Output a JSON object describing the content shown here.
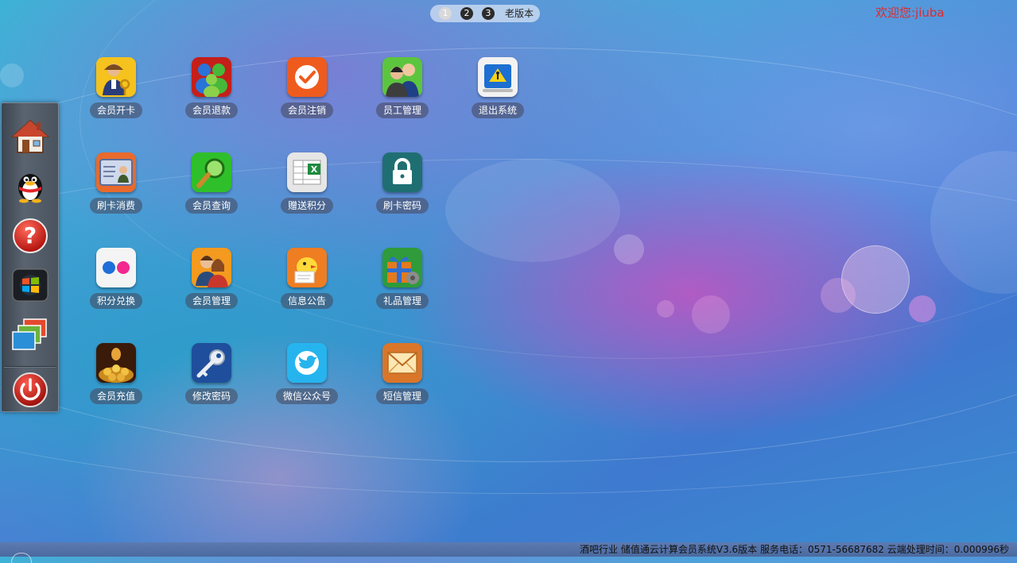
{
  "pager": {
    "pages": [
      "1",
      "2",
      "3"
    ],
    "active_page": "1",
    "old_version": "老版本"
  },
  "welcome": "欢迎您:jiuba",
  "dock": [
    "home-icon",
    "qq-penguin-icon",
    "help-icon",
    "windows-icon",
    "windows-stack-icon",
    "power-icon"
  ],
  "apps": [
    {
      "label": "会员开卡",
      "icon": "member-card-icon"
    },
    {
      "label": "会员退款",
      "icon": "refund-users-icon"
    },
    {
      "label": "会员注销",
      "icon": "checkmark-icon"
    },
    {
      "label": "员工管理",
      "icon": "staff-icon"
    },
    {
      "label": "退出系统",
      "icon": "exit-icon"
    },
    {
      "label": "刷卡消费",
      "icon": "id-card-icon"
    },
    {
      "label": "会员查询",
      "icon": "magnifier-icon"
    },
    {
      "label": "赠送积分",
      "icon": "spreadsheet-icon"
    },
    {
      "label": "刷卡密码",
      "icon": "lock-icon"
    },
    {
      "label": "积分兑换",
      "icon": "flickr-icon"
    },
    {
      "label": "会员管理",
      "icon": "member-pair-icon"
    },
    {
      "label": "信息公告",
      "icon": "chick-notice-icon"
    },
    {
      "label": "礼品管理",
      "icon": "gift-icon"
    },
    {
      "label": "会员充值",
      "icon": "gold-coins-icon"
    },
    {
      "label": "修改密码",
      "icon": "key-icon"
    },
    {
      "label": "微信公众号",
      "icon": "bird-icon"
    },
    {
      "label": "短信管理",
      "icon": "envelope-icon"
    }
  ],
  "status_bar": "酒吧行业 储值通云计算会员系统V3.6版本 服务电话：0571-56687682 云端处理时间：0.000996秒"
}
